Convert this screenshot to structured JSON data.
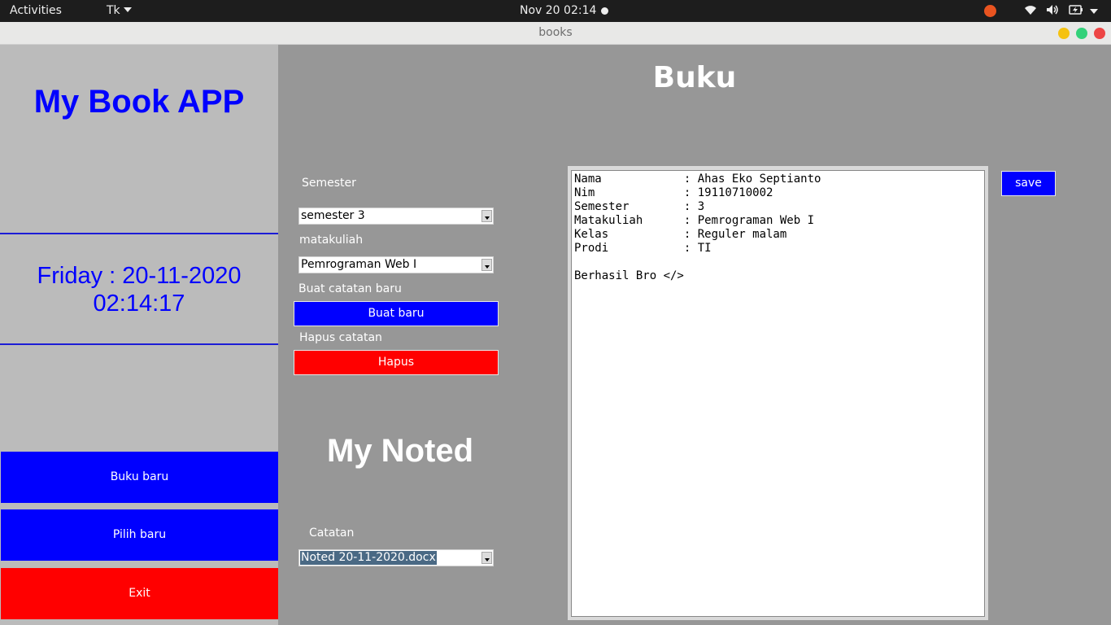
{
  "topbar": {
    "activities": "Activities",
    "app_menu": "Tk",
    "clock": "Nov 20  02:14"
  },
  "window": {
    "title": "books"
  },
  "sidebar": {
    "app_title": "My Book APP",
    "date": "Friday : 20-11-2020",
    "time": "02:14:17",
    "buttons": {
      "buku_baru": "Buku baru",
      "pilih_baru": "Pilih baru",
      "exit": "Exit"
    }
  },
  "main": {
    "title": "Buku",
    "semester_label": "Semester",
    "semester_value": "semester 3",
    "matakuliah_label": "matakuliah",
    "matakuliah_value": "Pemrograman Web I",
    "buat_label": "Buat catatan baru",
    "buat_button": "Buat baru",
    "hapus_label": "Hapus catatan",
    "hapus_button": "Hapus",
    "noted_title": "My Noted",
    "catatan_label": "Catatan",
    "catatan_value": "Noted 20-11-2020.docx",
    "save_button": "save",
    "editor_text": "Nama            : Ahas Eko Septianto\nNim             : 19110710002\nSemester        : 3\nMatakuliah      : Pemrograman Web I\nKelas           : Reguler malam\nProdi           : TI\n\nBerhasil Bro </>"
  },
  "colors": {
    "accent_blue": "#0000ff",
    "danger_red": "#ff0000",
    "panel_gray": "#bbbbbb",
    "main_gray": "#979797"
  }
}
